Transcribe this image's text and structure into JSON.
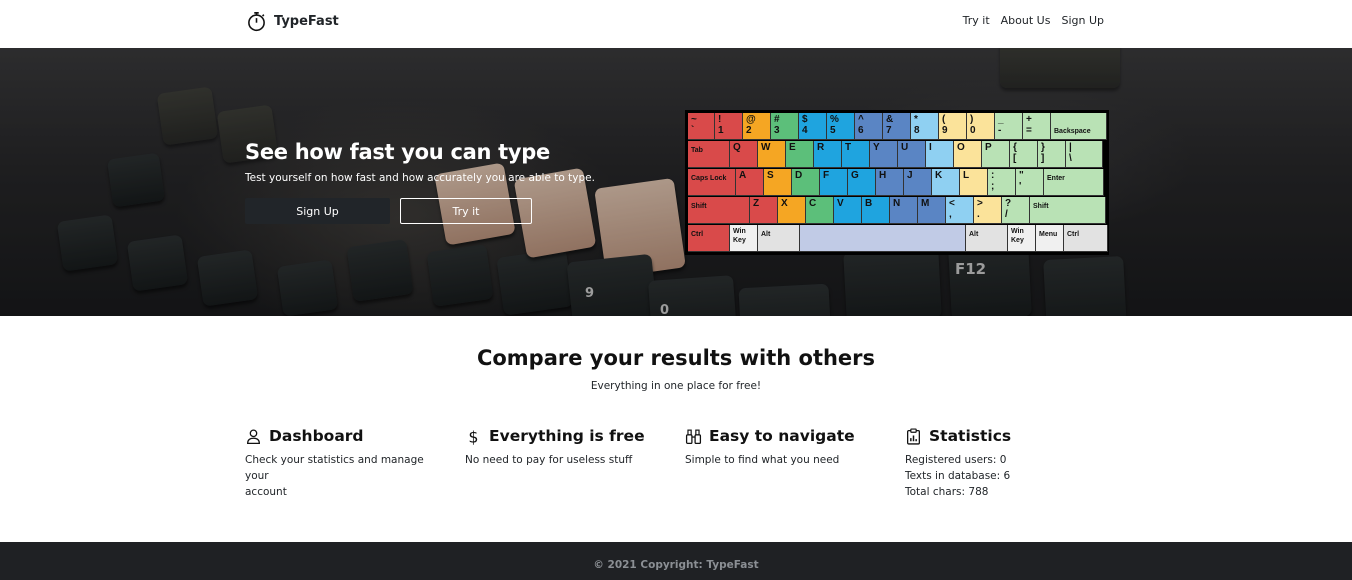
{
  "app": {
    "name": "TypeFast",
    "logo_icon": "stopwatch-icon"
  },
  "nav": {
    "items": [
      "Try it",
      "About Us",
      "Sign Up"
    ]
  },
  "hero": {
    "title": "See how fast you can type",
    "subtitle": "Test yourself on how fast and how accurately you are able to type.",
    "signup_label": "Sign Up",
    "try_label": "Try it"
  },
  "keyboard": {
    "rows": [
      [
        [
          "~\n`",
          "red"
        ],
        [
          "!\n1",
          "red"
        ],
        [
          "@\n2",
          "orange"
        ],
        [
          "#\n3",
          "green"
        ],
        [
          "$\n4",
          "blue"
        ],
        [
          "%\n5",
          "blue"
        ],
        [
          "^\n6",
          "navy"
        ],
        [
          "&\n7",
          "navy"
        ],
        [
          "*\n8",
          "lblue"
        ],
        [
          "(\n9",
          "yellow"
        ],
        [
          ")\n0",
          "yellow"
        ],
        [
          "_\n-",
          "mint"
        ],
        [
          "+\n=",
          "mint"
        ],
        [
          "Backspace",
          "mint"
        ]
      ],
      [
        [
          "Tab",
          "red"
        ],
        [
          "Q",
          "red"
        ],
        [
          "W",
          "orange"
        ],
        [
          "E",
          "green"
        ],
        [
          "R",
          "blue"
        ],
        [
          "T",
          "blue"
        ],
        [
          "Y",
          "navy"
        ],
        [
          "U",
          "navy"
        ],
        [
          "I",
          "lblue"
        ],
        [
          "O",
          "yellow"
        ],
        [
          "P",
          "mint"
        ],
        [
          "{\n[",
          "mint"
        ],
        [
          "}\n]",
          "mint"
        ],
        [
          "|\n\\",
          "mint"
        ]
      ],
      [
        [
          "Caps Lock",
          "red"
        ],
        [
          "A",
          "red"
        ],
        [
          "S",
          "orange"
        ],
        [
          "D",
          "green"
        ],
        [
          "F",
          "blue"
        ],
        [
          "G",
          "blue"
        ],
        [
          "H",
          "navy"
        ],
        [
          "J",
          "navy"
        ],
        [
          "K",
          "lblue"
        ],
        [
          "L",
          "yellow"
        ],
        [
          ":\n;",
          "mint"
        ],
        [
          "\"\n'",
          "mint"
        ],
        [
          "Enter",
          "mint"
        ]
      ],
      [
        [
          "Shift",
          "red"
        ],
        [
          "Z",
          "red"
        ],
        [
          "X",
          "orange"
        ],
        [
          "C",
          "green"
        ],
        [
          "V",
          "blue"
        ],
        [
          "B",
          "blue"
        ],
        [
          "N",
          "navy"
        ],
        [
          "M",
          "navy"
        ],
        [
          "<\n,",
          "lblue"
        ],
        [
          ">\n.",
          "yellow"
        ],
        [
          "?\n/",
          "mint"
        ],
        [
          "Shift",
          "mint"
        ]
      ],
      [
        [
          "Ctrl",
          "red"
        ],
        [
          "Win\nKey",
          "white"
        ],
        [
          "Alt",
          "grey"
        ],
        [
          "",
          "space"
        ],
        [
          "Alt",
          "grey"
        ],
        [
          "Win\nKey",
          "white"
        ],
        [
          "Menu",
          "white"
        ],
        [
          "Ctrl",
          "grey"
        ]
      ]
    ]
  },
  "compare": {
    "title": "Compare your results with others",
    "subtitle": "Everything in one place for free!"
  },
  "features": [
    {
      "icon": "person-icon",
      "title": "Dashboard",
      "lines": [
        "Check your statistics and manage your",
        "account"
      ]
    },
    {
      "icon": "dollar-icon",
      "title": "Everything is free",
      "lines": [
        "No need to pay for useless stuff"
      ]
    },
    {
      "icon": "binoculars-icon",
      "title": "Easy to navigate",
      "lines": [
        "Simple to find what you need"
      ]
    },
    {
      "icon": "clipboard-data-icon",
      "title": "Statistics",
      "lines": [
        "Registered users: 0",
        "Texts in database: 6",
        "Total chars: 788"
      ]
    }
  ],
  "footer": {
    "text": "© 2021 Copyright: TypeFast"
  }
}
